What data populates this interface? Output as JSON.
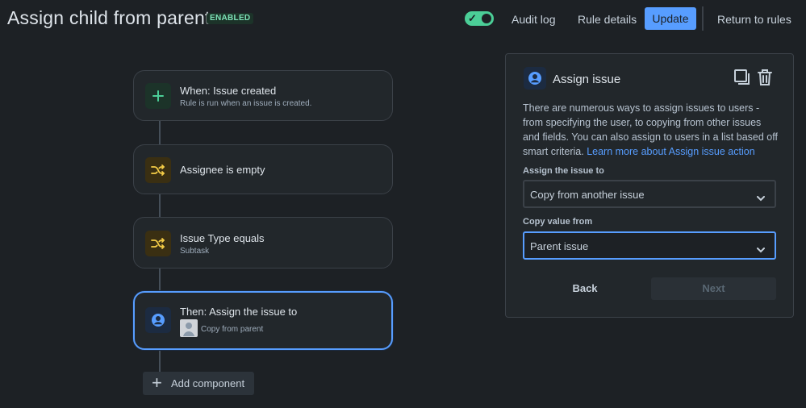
{
  "header": {
    "title": "Assign child from parent",
    "status_badge": "ENABLED",
    "toggle_enabled": true,
    "audit_log": "Audit log",
    "rule_details": "Rule details",
    "update": "Update",
    "return_to_rules": "Return to rules"
  },
  "flow": {
    "trigger": {
      "title": "When: Issue created",
      "subtitle": "Rule is run when an issue is created.",
      "icon": "plus-icon"
    },
    "condition1": {
      "title": "Assignee is empty",
      "icon": "shuffle-icon"
    },
    "condition2": {
      "title": "Issue Type equals",
      "subtitle": "Subtask",
      "icon": "shuffle-icon"
    },
    "action": {
      "title": "Then: Assign the issue to",
      "subtitle": "Copy from parent",
      "icon": "user-icon"
    },
    "add_component": "Add component"
  },
  "panel": {
    "title": "Assign issue",
    "description": "There are numerous ways to assign issues to users - from specifying the user, to copying from other issues and fields. You can also assign to users in a list based off smart criteria.",
    "learn_more": "Learn more about Assign issue action",
    "assign_label": "Assign the issue to",
    "assign_value": "Copy from another issue",
    "copy_label": "Copy value from",
    "copy_value": "Parent issue",
    "back": "Back",
    "next": "Next"
  },
  "colors": {
    "background": "#1d2125",
    "accent": "#579dff",
    "toggle_on": "#4bce97",
    "condition_icon": "#f5cd47"
  }
}
